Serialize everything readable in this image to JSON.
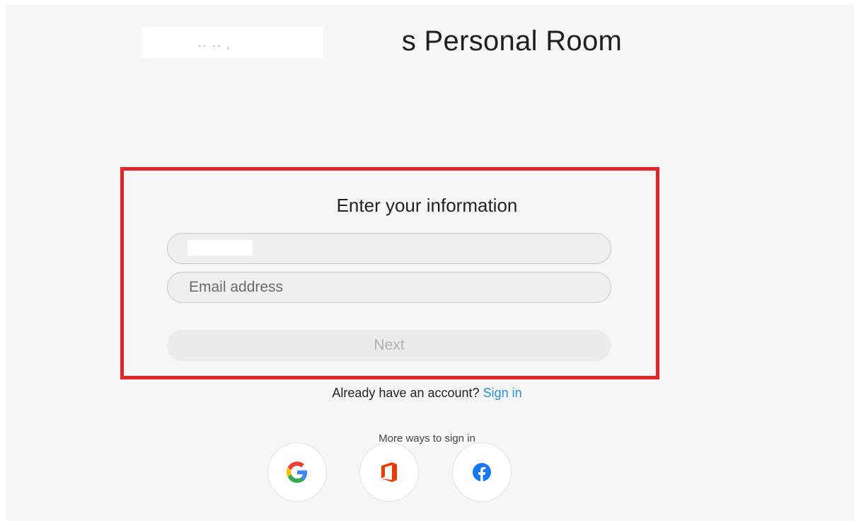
{
  "header": {
    "room_title": "s Personal Room"
  },
  "form": {
    "heading": "Enter your information",
    "name_field": {
      "value": ""
    },
    "email_field": {
      "placeholder": "Email address"
    },
    "next_label": "Next"
  },
  "account": {
    "prompt": "Already have an account?",
    "sign_in_label": "Sign in"
  },
  "more_ways": {
    "label": "More ways to sign in",
    "providers": [
      {
        "name": "google",
        "icon": "google-icon"
      },
      {
        "name": "office",
        "icon": "office-icon"
      },
      {
        "name": "facebook",
        "icon": "facebook-icon"
      }
    ]
  },
  "colors": {
    "highlight": "#e3242b",
    "link": "#2b8fd6",
    "facebook": "#1877f2",
    "office": "#eb3c00"
  }
}
